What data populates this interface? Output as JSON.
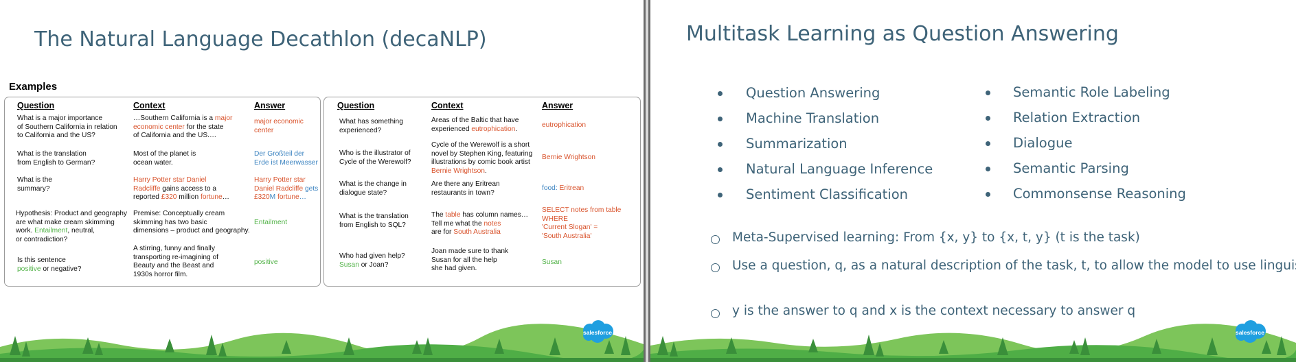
{
  "left_slide": {
    "title": "The Natural Language Decathlon (decaNLP)",
    "examples_label": "Examples",
    "headers": {
      "question": "Question",
      "context": "Context",
      "answer": "Answer"
    },
    "panel1": [
      {
        "question": [
          {
            "t": "What is a major importance\n of Southern California in relation\n to California and the US?"
          }
        ],
        "context": [
          {
            "t": "…Southern California is a "
          },
          {
            "t": "major\n economic center",
            "c": "orange"
          },
          {
            "t": " for the state\n of California and the US.…"
          }
        ],
        "answer": [
          {
            "t": "major economic\ncenter",
            "c": "orange"
          }
        ]
      },
      {
        "question": [
          {
            "t": "What is the translation\nfrom English to German?"
          }
        ],
        "context": [
          {
            "t": "Most of the planet is\nocean water."
          }
        ],
        "answer": [
          {
            "t": "Der Großteil der\nErde ist Meerwasser",
            "c": "blue"
          }
        ]
      },
      {
        "question": [
          {
            "t": "What is the\nsummary?"
          }
        ],
        "context": [
          {
            "t": "Harry Potter star Daniel\nRadcliffe",
            "c": "orange"
          },
          {
            "t": " gains access to a\nreported "
          },
          {
            "t": "£320",
            "c": "orange"
          },
          {
            "t": " million "
          },
          {
            "t": "fortune",
            "c": "orange"
          },
          {
            "t": "…"
          }
        ],
        "answer": [
          {
            "t": "Harry Potter star\nDaniel Radcliffe",
            "c": "orange"
          },
          {
            "t": " gets",
            "c": "blue"
          },
          {
            "t": "\n£320",
            "c": "orange"
          },
          {
            "t": "M",
            "c": "blue"
          },
          {
            "t": " fortune",
            "c": "orange"
          },
          {
            "t": "…",
            "c": "blue"
          }
        ]
      },
      {
        "question": [
          {
            "t": "Hypothesis: Product and geography\nare what make cream  skimming\nwork. "
          },
          {
            "t": "Entailment",
            "c": "green"
          },
          {
            "t": ", neutral,\nor contradiction?"
          }
        ],
        "context": [
          {
            "t": "Premise: Conceptually cream\n skimming has two basic\ndimensions – product and geography."
          }
        ],
        "answer": [
          {
            "t": "Entailment",
            "c": "green"
          }
        ]
      },
      {
        "question": [
          {
            "t": "Is this sentence\n"
          },
          {
            "t": "positive",
            "c": "green"
          },
          {
            "t": " or negative?"
          }
        ],
        "context": [
          {
            "t": "A stirring, funny and finally\ntransporting re-imagining of\nBeauty and the Beast and\n1930s horror film."
          }
        ],
        "answer": [
          {
            "t": "positive",
            "c": "green"
          }
        ]
      }
    ],
    "panel2": [
      {
        "question": [
          {
            "t": "What has something\nexperienced?"
          }
        ],
        "context": [
          {
            "t": "Areas of the Baltic that have\n experienced "
          },
          {
            "t": "eutrophication",
            "c": "orange"
          },
          {
            "t": "."
          }
        ],
        "answer": [
          {
            "t": "eutrophication",
            "c": "orange"
          }
        ]
      },
      {
        "question": [
          {
            "t": "Who is the illustrator of\nCycle of the Werewolf?"
          }
        ],
        "context": [
          {
            "t": "Cycle of the Werewolf is a short\nnovel by Stephen King, featuring\nillustrations by comic book artist\n"
          },
          {
            "t": "Bernie Wrightson",
            "c": "orange"
          },
          {
            "t": "."
          }
        ],
        "answer": [
          {
            "t": "Bernie Wrightson",
            "c": "orange"
          }
        ]
      },
      {
        "question": [
          {
            "t": "What is the change in\ndialogue state?"
          }
        ],
        "context": [
          {
            "t": "Are there any Eritrean\nrestaurants in town?"
          }
        ],
        "answer": [
          {
            "t": "food: ",
            "c": "blue"
          },
          {
            "t": "Eritrean",
            "c": "orange"
          }
        ]
      },
      {
        "question": [
          {
            "t": "What is the translation\nfrom English to SQL?"
          }
        ],
        "context": [
          {
            "t": "The "
          },
          {
            "t": "table",
            "c": "orange"
          },
          {
            "t": " has column names…\nTell me what the "
          },
          {
            "t": "notes",
            "c": "orange"
          },
          {
            "t": "\nare for "
          },
          {
            "t": "South Australia",
            "c": "orange"
          }
        ],
        "answer": [
          {
            "t": "SELECT notes from table\nWHERE\n'Current Slogan' =\n'South Australia'",
            "c": "orange"
          }
        ]
      },
      {
        "question": [
          {
            "t": "Who had given help?\n"
          },
          {
            "t": "Susan",
            "c": "green"
          },
          {
            "t": " or Joan?"
          }
        ],
        "context": [
          {
            "t": "Joan made sure to thank\n Susan for all the help\n she had given."
          }
        ],
        "answer": [
          {
            "t": "Susan",
            "c": "green"
          }
        ]
      }
    ],
    "logo_text": "salesforce"
  },
  "right_slide": {
    "title": "Multitask Learning as Question Answering",
    "tasks_left": [
      "Question Answering",
      "Machine Translation",
      "Summarization",
      "Natural Language Inference",
      "Sentiment Classification"
    ],
    "tasks_right": [
      "Semantic Role Labeling",
      "Relation Extraction",
      "Dialogue",
      "Semantic Parsing",
      "Commonsense Reasoning"
    ],
    "points": [
      "Meta-Supervised learning: From {x, y} to {x, t, y} (t is the task)",
      "Use a question, q,  as a natural description of the task, t, to allow the\nmodel to use linguistic information to connect tasks",
      "y is the answer to q and x is the context necessary to answer q"
    ],
    "logo_text": "salesforce"
  },
  "colors": {
    "title": "#3e6378",
    "orange": "#d9532c",
    "green": "#53b349",
    "blue": "#3b83c0",
    "salesforce_blue": "#1f9fe0",
    "forest_dark": "#3a8f3a",
    "forest_light": "#7dc55a"
  }
}
